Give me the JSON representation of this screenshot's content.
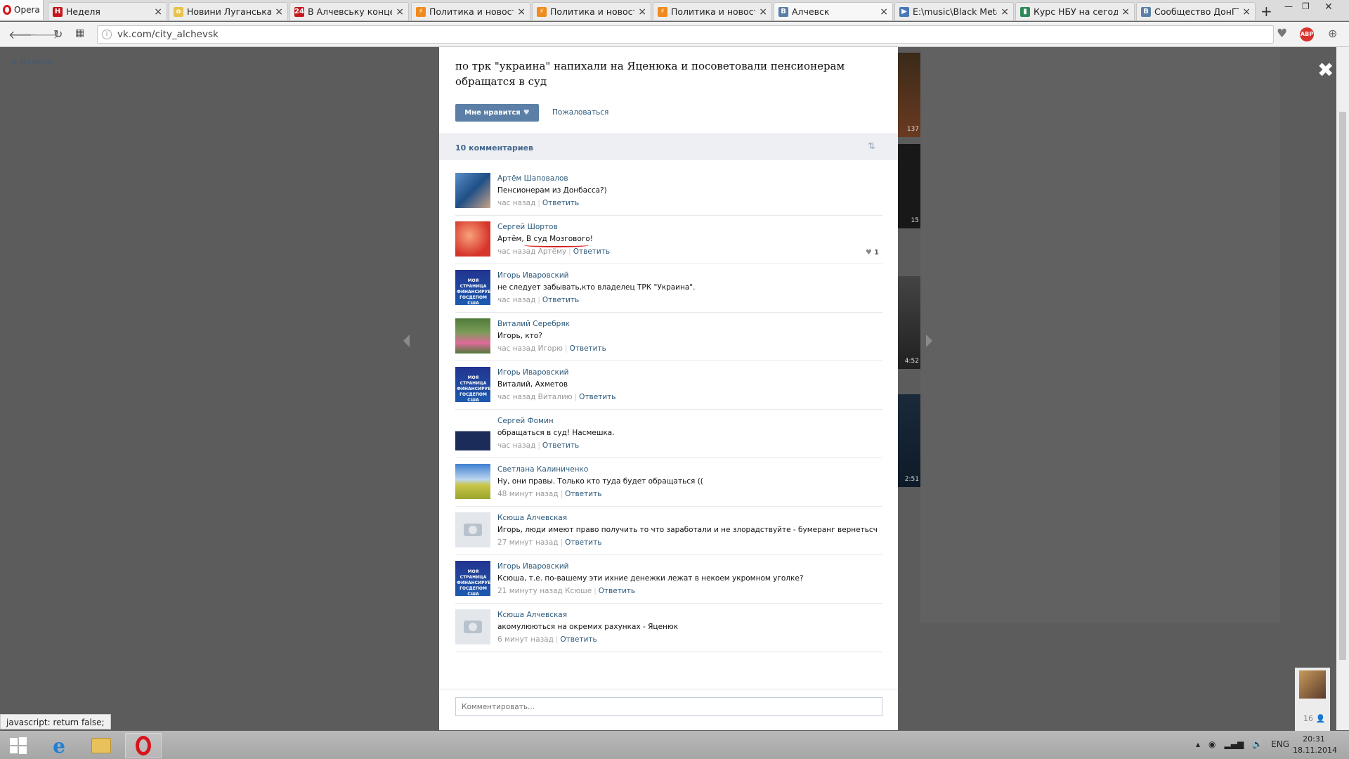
{
  "browser": {
    "menu_label": "Opera",
    "tabs": [
      {
        "label": "Неделя",
        "icon": "h-icon",
        "color": "#c4161c",
        "glyph": "H"
      },
      {
        "label": "Новини Луганська. С",
        "icon": "news-icon",
        "color": "#e8c24a",
        "glyph": "o"
      },
      {
        "label": "В Алчевську концент",
        "icon": "24-icon",
        "color": "#c4161c",
        "glyph": "24"
      },
      {
        "label": "Политика и новости",
        "icon": "lightning-icon",
        "color": "#f08a1c",
        "glyph": "⚡"
      },
      {
        "label": "Политика и новости",
        "icon": "lightning-icon",
        "color": "#f08a1c",
        "glyph": "⚡"
      },
      {
        "label": "Политика и новости",
        "icon": "lightning-icon",
        "color": "#f08a1c",
        "glyph": "⚡"
      },
      {
        "label": "Алчевск",
        "icon": "vk-icon",
        "color": "#5b7fa6",
        "glyph": "B"
      },
      {
        "label": "E:\\music\\Black Metal",
        "icon": "play-icon",
        "color": "#4a78b8",
        "glyph": "▶"
      },
      {
        "label": "Курс НБУ на сегодня",
        "icon": "chart-icon",
        "color": "#2e8b57",
        "glyph": "▮"
      },
      {
        "label": "Сообщество ДонГТУ",
        "icon": "vk-icon",
        "color": "#5b7fa6",
        "glyph": "B"
      }
    ],
    "url": "vk.com/city_alchevsk"
  },
  "page": {
    "back_label": "Наверх",
    "thumb_labels": [
      "137",
      "15",
      "4:52",
      "2:51"
    ]
  },
  "post": {
    "text": "по трк \"украина\" напихали на Яценюка и посоветовали пенсионерам обращатся в суд",
    "like_label": "Мне нравится",
    "report_label": "Пожаловаться"
  },
  "comments_header": {
    "count_label": "10 комментариев"
  },
  "comments": [
    {
      "author": "Артём Шаповалов",
      "text": "Пенсионерам из Донбасса?)",
      "time": "час назад",
      "reply": "Ответить",
      "avatar": "photo-man"
    },
    {
      "author": "Сергей Шортов",
      "text": "Артём, В суд Мозгового!",
      "time": "час назад Артёму",
      "reply": "Ответить",
      "avatar": "photo-red",
      "likes": "1"
    },
    {
      "author": "Игорь Иваровский",
      "text": "не следует забывать,кто владелец ТРК \"Украина\".",
      "time": "час назад",
      "reply": "Ответить",
      "avatar": "banner"
    },
    {
      "author": "Виталий Серебряк",
      "text": "Игорь, кто?",
      "time": "час назад Игорю",
      "reply": "Ответить",
      "avatar": "photo-girl"
    },
    {
      "author": "Игорь Иваровский",
      "text": "Виталий, Ахметов",
      "time": "час назад Виталию",
      "reply": "Ответить",
      "avatar": "banner"
    },
    {
      "author": "Сергей Фомин",
      "text": "обращаться в суд! Насмешка.",
      "time": "час назад",
      "reply": "Ответить",
      "avatar": "cartoon"
    },
    {
      "author": "Светлана Калиниченко",
      "text": "Ну, они правы. Только кто туда будет обращаться ((",
      "time": "48 минут назад",
      "reply": "Ответить",
      "avatar": "field"
    },
    {
      "author": "Ксюша Алчевская",
      "text": "Игорь, люди имеют право получить то что заработали и не злорадствуйте - бумеранг вернетьсч",
      "time": "27 минут назад",
      "reply": "Ответить",
      "avatar": "camera"
    },
    {
      "author": "Игорь Иваровский",
      "text": "Ксюша, т.е. по-вашему эти ихние денежки лежат в некоем укромном уголке?",
      "time": "21 минуту назад Ксюше",
      "reply": "Ответить",
      "avatar": "banner"
    },
    {
      "author": "Ксюша Алчевская",
      "text": "акомулюються на окремих рахунках - Яценюк",
      "time": "6 минут назад",
      "reply": "Ответить",
      "avatar": "camera"
    }
  ],
  "banner_text": "МОЯ СТРАНИЦА ФИНАНСИРУЕТСЯ ГОСДЕПОМ США",
  "comment_box": {
    "placeholder": "Комментировать..."
  },
  "status_tip": "javascript: return false;",
  "chat": {
    "online_count": "16"
  },
  "taskbar": {
    "lang": "ENG",
    "time": "20:31",
    "date": "18.11.2014"
  }
}
